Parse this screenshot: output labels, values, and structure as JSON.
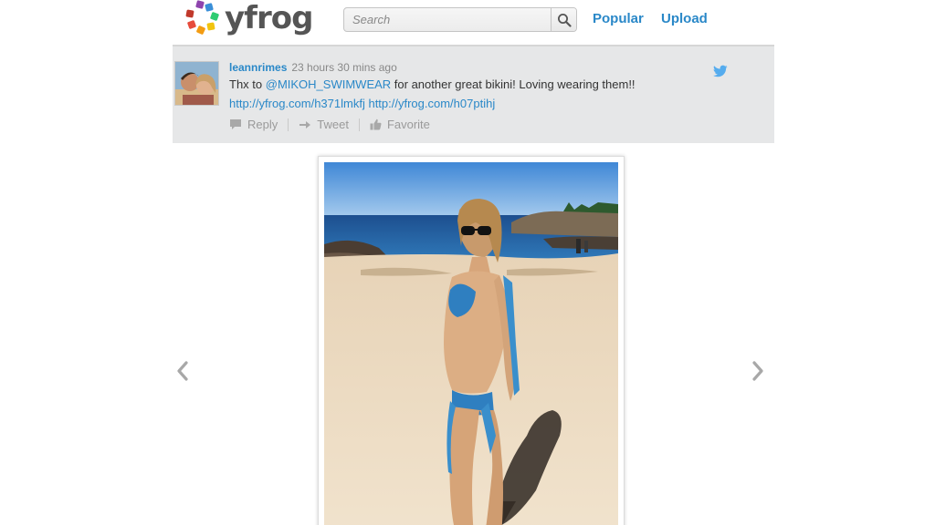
{
  "brand": {
    "name": "yfrog"
  },
  "search": {
    "placeholder": "Search"
  },
  "nav": {
    "popular": "Popular",
    "upload": "Upload"
  },
  "tweet": {
    "username": "leannrimes",
    "time": "23 hours 30 mins ago",
    "text_prefix": "Thx to ",
    "mention": "@MIKOH_SWIMWEAR",
    "text_suffix": " for another great bikini! Loving wearing them!!",
    "link1": "http://yfrog.com/h371lmkfj",
    "link2": "http://yfrog.com/h07ptihj",
    "actions": {
      "reply": "Reply",
      "tweet": "Tweet",
      "favorite": "Favorite"
    }
  },
  "colors": {
    "link": "#2a88c8",
    "panel": "#e6e7e8",
    "twitter": "#55acee"
  }
}
